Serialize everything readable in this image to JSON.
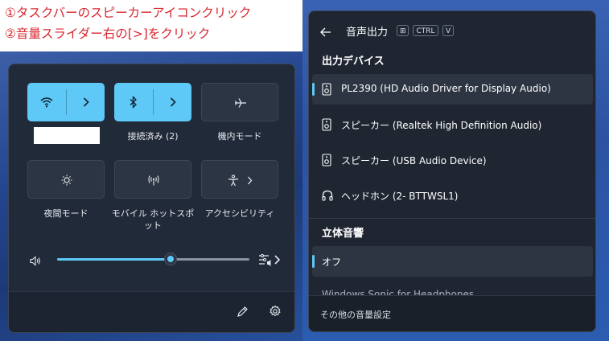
{
  "instructions": {
    "step1": "①タスクバーのスピーカーアイコンクリック",
    "step2": "②音量スライダー右の[>]をクリック"
  },
  "quick_settings": {
    "tiles": [
      {
        "label": "",
        "icon": "wifi-icon",
        "state": "on",
        "has_arrow": true
      },
      {
        "label": "接続済み (2)",
        "icon": "bluetooth-icon",
        "state": "on",
        "has_arrow": true
      },
      {
        "label": "機内モード",
        "icon": "airplane-icon",
        "state": "off",
        "has_arrow": false
      },
      {
        "label": "夜間モード",
        "icon": "brightness-icon",
        "state": "off",
        "has_arrow": false
      },
      {
        "label": "モバイル ホットスポット",
        "icon": "hotspot-icon",
        "state": "off",
        "has_arrow": false
      },
      {
        "label": "アクセシビリティ",
        "icon": "accessibility-icon",
        "state": "off",
        "has_arrow": true
      }
    ],
    "volume": {
      "level_percent": 59,
      "icon": "speaker-icon",
      "output_icon": "audio-output-select-icon"
    },
    "footer": {
      "edit_icon": "pencil-icon",
      "settings_icon": "gear-icon"
    },
    "accent_color": "#5ec8f7"
  },
  "sound_output": {
    "title": "音声出力",
    "shortcut_keys": [
      "⊞",
      "CTRL",
      "V"
    ],
    "section_devices": "出力デバイス",
    "devices": [
      {
        "name": "PL2390 (HD Audio Driver for Display Audio)",
        "icon": "speaker-device-icon",
        "selected": true
      },
      {
        "name": "スピーカー (Realtek High Definition Audio)",
        "icon": "speaker-device-icon",
        "selected": false
      },
      {
        "name": "スピーカー (USB Audio Device)",
        "icon": "speaker-device-icon",
        "selected": false
      },
      {
        "name": "ヘッドホン (2- BTTWSL1)",
        "icon": "headphones-icon",
        "selected": false
      }
    ],
    "section_spatial": "立体音響",
    "spatial_options": [
      {
        "name": "オフ",
        "selected": true
      }
    ],
    "partial_item": "Windows Sonic for Headphones",
    "footer_link": "その他の音量設定"
  }
}
